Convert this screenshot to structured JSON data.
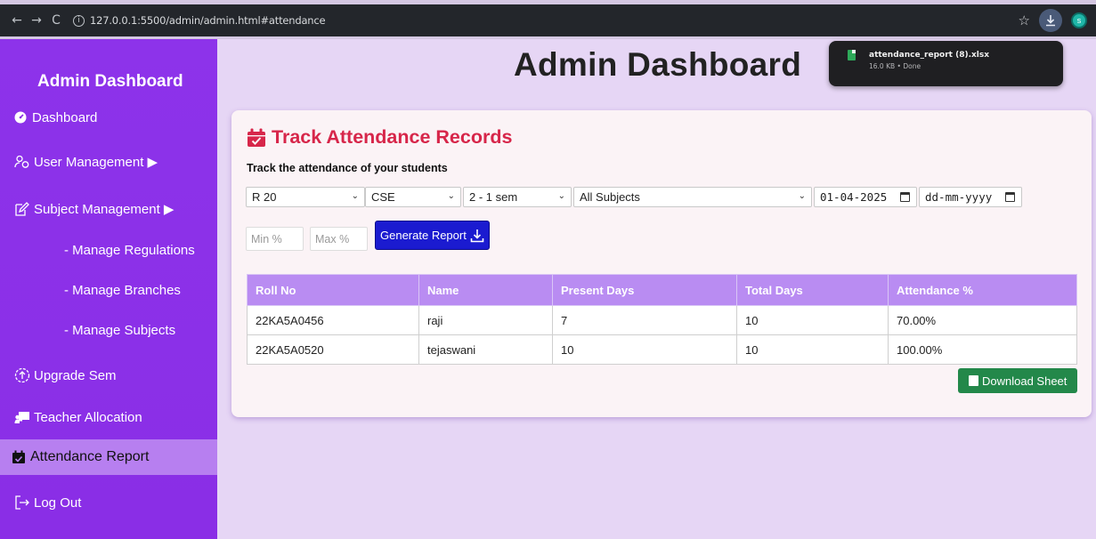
{
  "browser": {
    "back": "←",
    "forward": "→",
    "reload": "C",
    "url": "127.0.0.1:5500/admin/admin.html#attendance",
    "profile_initial": "s"
  },
  "download_popup": {
    "filename": "attendance_report (8).xlsx",
    "meta": "16.0 KB • Done"
  },
  "sidebar": {
    "title": "Admin Dashboard",
    "items": {
      "dashboard": "Dashboard",
      "user_management": "User Management ▶",
      "subject_management": "Subject Management ▶",
      "manage_regulations": "- Manage Regulations",
      "manage_branches": "- Manage Branches",
      "manage_subjects": "- Manage Subjects",
      "upgrade_sem": "Upgrade Sem",
      "teacher_allocation": "Teacher Allocation",
      "attendance_report": "Attendance Report",
      "log_out": "Log Out"
    }
  },
  "header": {
    "title": "Admin Dashboard"
  },
  "card": {
    "title": "Track Attendance Records",
    "subtitle": "Track the attendance of your students",
    "filters": {
      "regulation": "R 20",
      "branch": "CSE",
      "semester": "2 - 1 sem",
      "subject": "All Subjects",
      "from_date": "01-04-2025",
      "to_date": "dd-mm-yyyy",
      "min_placeholder": "Min %",
      "max_placeholder": "Max %"
    },
    "generate_label": "Generate Report",
    "download_label": "Download Sheet",
    "table": {
      "headers": [
        "Roll No",
        "Name",
        "Present Days",
        "Total Days",
        "Attendance %"
      ],
      "rows": [
        [
          "22KA5A0456",
          "raji",
          "7",
          "10",
          "70.00%"
        ],
        [
          "22KA5A0520",
          "tejaswani",
          "10",
          "10",
          "100.00%"
        ]
      ]
    }
  }
}
